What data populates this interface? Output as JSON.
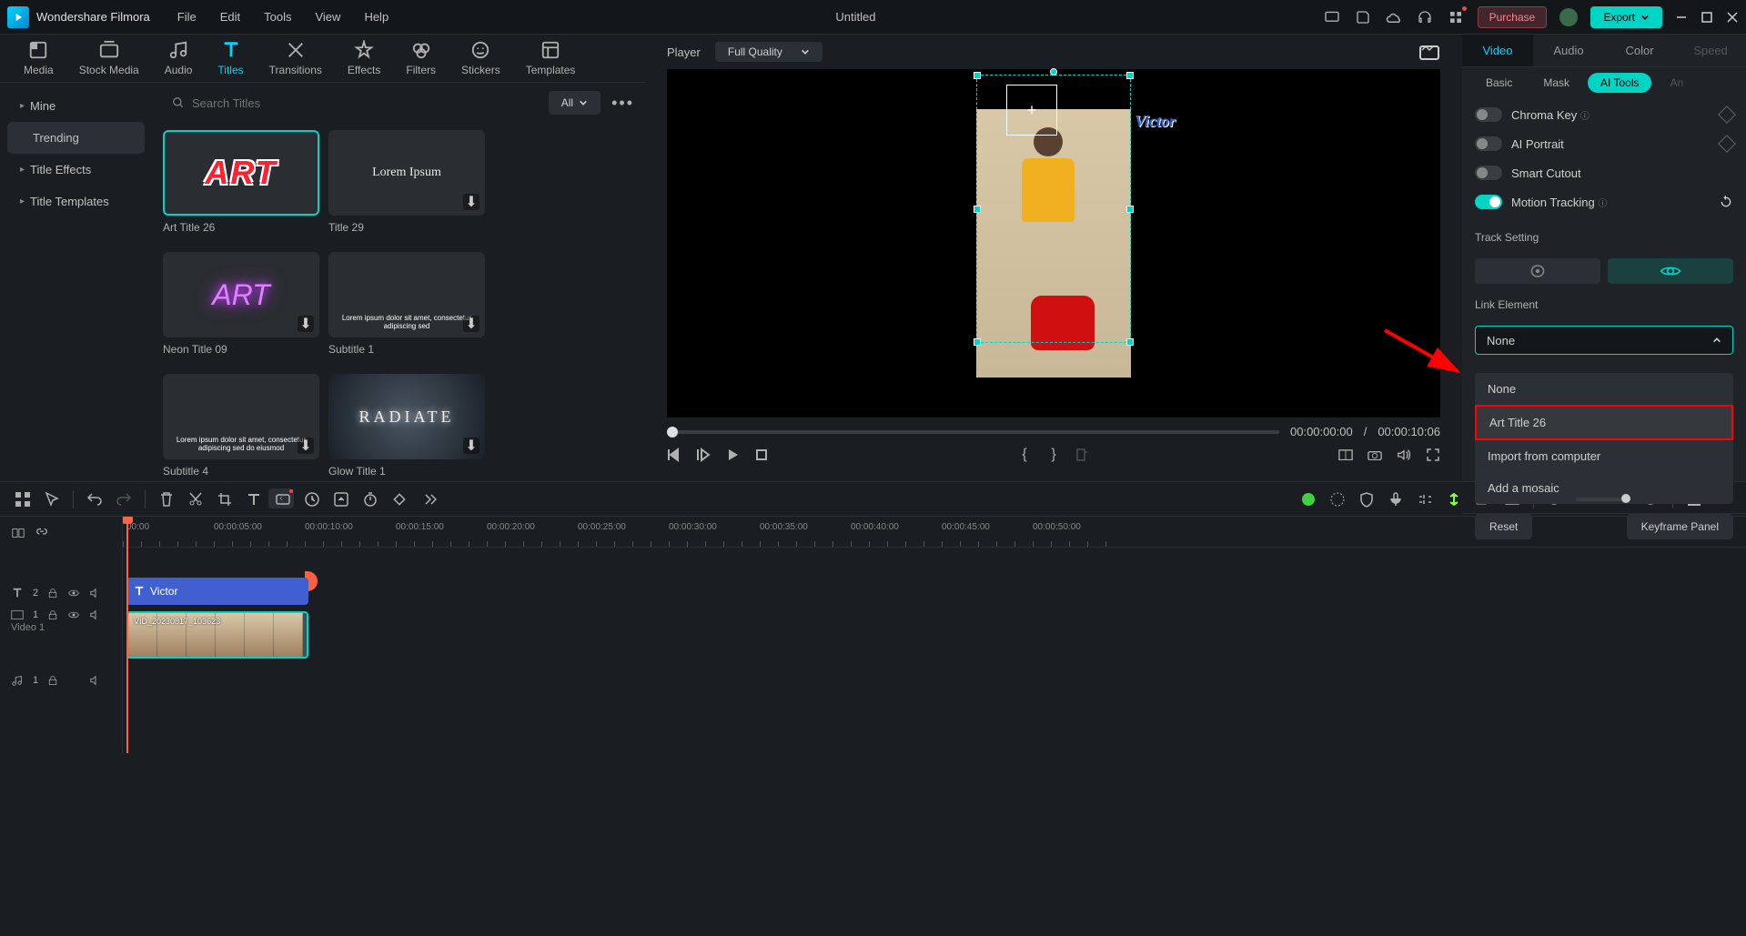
{
  "app_name": "Wondershare Filmora",
  "menu": [
    "File",
    "Edit",
    "Tools",
    "View",
    "Help"
  ],
  "document_title": "Untitled",
  "purchase_label": "Purchase",
  "export_label": "Export",
  "toolbar_tabs": {
    "media": "Media",
    "stock_media": "Stock Media",
    "audio": "Audio",
    "titles": "Titles",
    "transitions": "Transitions",
    "effects": "Effects",
    "filters": "Filters",
    "stickers": "Stickers",
    "templates": "Templates"
  },
  "sidebar": {
    "mine": "Mine",
    "trending": "Trending",
    "title_effects": "Title Effects",
    "title_templates": "Title Templates"
  },
  "search_placeholder": "Search Titles",
  "filter_all": "All",
  "grid": {
    "items": [
      {
        "name": "Art Title 26",
        "preview": "ART"
      },
      {
        "name": "Title 29",
        "preview": "Lorem Ipsum"
      },
      {
        "name": "Neon Title 09",
        "preview": "ART"
      },
      {
        "name": "Subtitle 1",
        "preview": ""
      },
      {
        "name": "Subtitle 4",
        "preview": ""
      },
      {
        "name": "Glow Title 1",
        "preview": "RADIATE"
      }
    ]
  },
  "player": {
    "label": "Player",
    "quality": "Full Quality",
    "overlay_text": "Victor",
    "current_time": "00:00:00:00",
    "total_time": "00:00:10:06",
    "separator": "/"
  },
  "right_panel": {
    "tabs": {
      "video": "Video",
      "audio": "Audio",
      "color": "Color",
      "speed": "Speed"
    },
    "subtabs": {
      "basic": "Basic",
      "mask": "Mask",
      "ai_tools": "AI Tools",
      "animation": "An"
    },
    "chroma_key": "Chroma Key",
    "ai_portrait": "AI Portrait",
    "smart_cutout": "Smart Cutout",
    "motion_tracking": "Motion Tracking",
    "track_setting": "Track Setting",
    "link_element": "Link Element",
    "link_value": "None",
    "dropdown": {
      "none": "None",
      "art_title_26": "Art Title 26",
      "import_from_computer": "Import from computer",
      "add_mosaic": "Add a mosaic"
    },
    "reset": "Reset",
    "keyframe_panel": "Keyframe Panel"
  },
  "timeline": {
    "ruler": [
      "00:00",
      "00:00:05:00",
      "00:00:10:00",
      "00:00:15:00",
      "00:00:20:00",
      "00:00:25:00",
      "00:00:30:00",
      "00:00:35:00",
      "00:00:40:00",
      "00:00:45:00",
      "00:00:50:00"
    ],
    "title_clip": "Victor",
    "video_clip": "VID_20230817_103623",
    "video_track_label": "Video 1",
    "track_t_count": "2",
    "track_v_count": "1",
    "track_a_count": "1"
  }
}
